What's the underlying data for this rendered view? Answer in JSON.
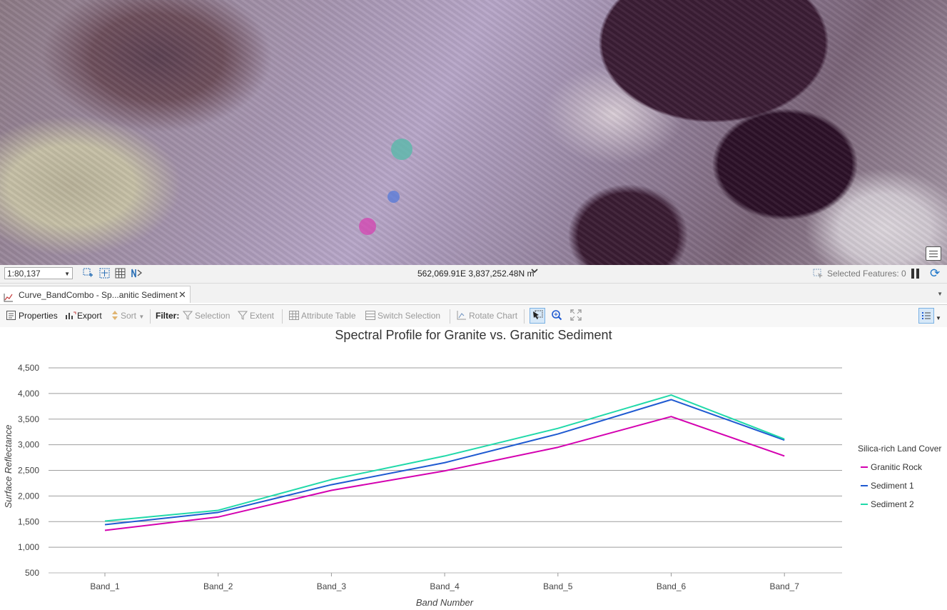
{
  "map": {
    "map_options_icon": "map-options-icon"
  },
  "statusbar": {
    "scale": "1:80,137",
    "coordinates": "562,069.91E 3,837,252.48N m",
    "selected_features": "Selected Features: 0",
    "icons": [
      "fixed-zoom-icon",
      "navigation-icon",
      "grid-icon",
      "snapping-icon",
      "pause-icon",
      "refresh-icon"
    ]
  },
  "tab": {
    "label": "Curve_BandCombo - Sp...anitic Sediment",
    "close": "✕"
  },
  "toolbar": {
    "properties": "Properties",
    "export": "Export",
    "sort": "Sort",
    "filter": "Filter:",
    "selection": "Selection",
    "extent": "Extent",
    "attribute_table": "Attribute Table",
    "switch_selection": "Switch Selection",
    "rotate_chart": "Rotate Chart"
  },
  "colors": {
    "granitic_rock": "#d400b0",
    "sediment_1": "#1f5ad1",
    "sediment_2": "#20d9a9"
  },
  "chart_data": {
    "type": "line",
    "title": "Spectral Profile for Granite vs. Granitic Sediment",
    "xlabel": "Band Number",
    "ylabel": "Surface Reflectance",
    "categories": [
      "Band_1",
      "Band_2",
      "Band_3",
      "Band_4",
      "Band_5",
      "Band_6",
      "Band_7"
    ],
    "ylim": [
      500,
      4500
    ],
    "yticks": [
      500,
      1000,
      1500,
      2000,
      2500,
      3000,
      3500,
      4000,
      4500
    ],
    "ytick_labels": [
      "500",
      "1,000",
      "1,500",
      "2,000",
      "2,500",
      "3,000",
      "3,500",
      "4,000",
      "4,500"
    ],
    "grid": true,
    "legend_title": "Silica-rich Land Cover",
    "legend_position": "right",
    "series": [
      {
        "name": "Granitic Rock",
        "color": "#d400b0",
        "values": [
          1330,
          1590,
          2110,
          2490,
          2950,
          3550,
          2780
        ]
      },
      {
        "name": "Sediment 1",
        "color": "#1f5ad1",
        "values": [
          1440,
          1680,
          2220,
          2650,
          3210,
          3880,
          3090
        ]
      },
      {
        "name": "Sediment 2",
        "color": "#20d9a9",
        "values": [
          1510,
          1720,
          2320,
          2780,
          3320,
          3970,
          3110
        ]
      }
    ]
  }
}
